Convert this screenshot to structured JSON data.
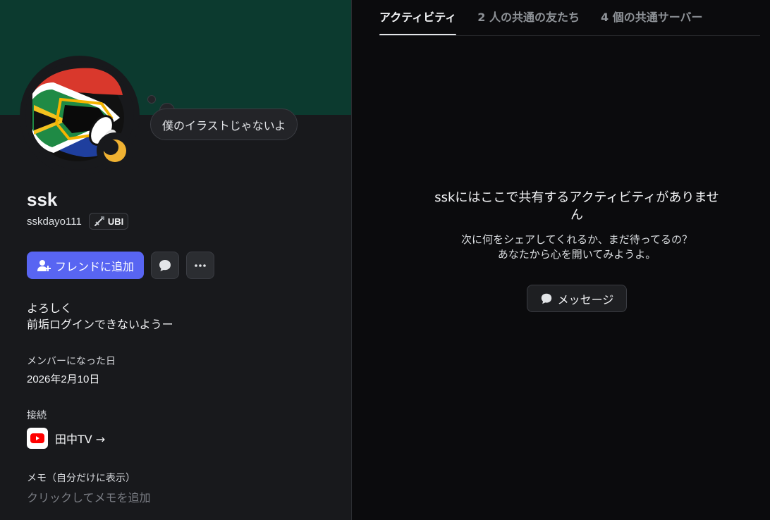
{
  "profile": {
    "display_name": "ssk",
    "username": "sskdayo111",
    "clan_tag": "UBI",
    "custom_status": "僕のイラストじゃないよ",
    "status": "idle",
    "banner_color": "#0c3a2f",
    "bio_lines": [
      "よろしく",
      "前垢ログインできないようー"
    ]
  },
  "actions": {
    "add_friend_label": "フレンドに追加",
    "message_icon": "chat-bubble-icon",
    "more_icon": "ellipsis-icon"
  },
  "member_since": {
    "label": "メンバーになった日",
    "date": "2026年2月10日"
  },
  "connections": {
    "label": "接続",
    "items": [
      {
        "service_icon": "youtube-icon",
        "name": "田中TV →"
      }
    ]
  },
  "note": {
    "label": "メモ（自分だけに表示）",
    "placeholder": "クリックしてメモを追加"
  },
  "tabs": [
    {
      "label": "アクティビティ",
      "active": true
    },
    {
      "label": "2 人の共通の友たち",
      "active": false
    },
    {
      "label": "4 個の共通サーバー",
      "active": false
    }
  ],
  "activity": {
    "empty_title": "sskにはここで共有するアクティビティがありません",
    "empty_sub_line1": "次に何をシェアしてくれるか、まだ待ってるの？",
    "empty_sub_line2": "あなたから心を開いてみようよ。",
    "message_button_label": "メッセージ"
  },
  "colors": {
    "accent": "#5865f2",
    "idle": "#f0b232",
    "youtube": "#ff0000"
  }
}
